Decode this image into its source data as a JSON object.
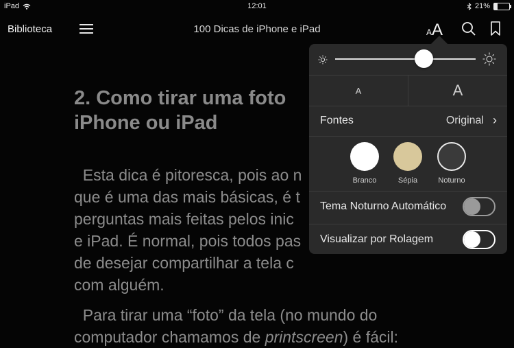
{
  "status": {
    "device": "iPad",
    "time": "12:01",
    "battery": "21%",
    "battery_level": 0.21
  },
  "nav": {
    "back_label": "Biblioteca",
    "title": "100 Dicas de iPhone e iPad",
    "aa_small": "A",
    "aa_big": "A"
  },
  "content": {
    "heading_line1": "2. Como tirar uma foto",
    "heading_line2": "iPhone ou iPad",
    "para1": [
      "  Esta dica é pitoresca, pois ao n",
      "que é uma das mais básicas, é t",
      "perguntas mais feitas pelos inic",
      "e iPad. É normal, pois todos pas",
      "de desejar compartilhar a tela c",
      "com alguém."
    ],
    "para2_line1": "  Para tirar uma “foto” da tela (no mundo do",
    "para2_line2_pre": "computador chamamos de ",
    "para2_line2_em": "printscreen",
    "para2_line2_post": ") é fácil:"
  },
  "popover": {
    "brightness_level": 0.63,
    "size_small_label": "A",
    "size_big_label": "A",
    "fonts_label": "Fontes",
    "fonts_value": "Original",
    "themes": [
      {
        "label": "Branco",
        "color": "#ffffff"
      },
      {
        "label": "Sépia",
        "color": "#d8c89b"
      },
      {
        "label": "Noturno",
        "color": "#3a3a3a"
      }
    ],
    "auto_night_label": "Tema Noturno Automático",
    "auto_night_on": false,
    "scroll_label": "Visualizar por Rolagem",
    "scroll_on": false
  }
}
